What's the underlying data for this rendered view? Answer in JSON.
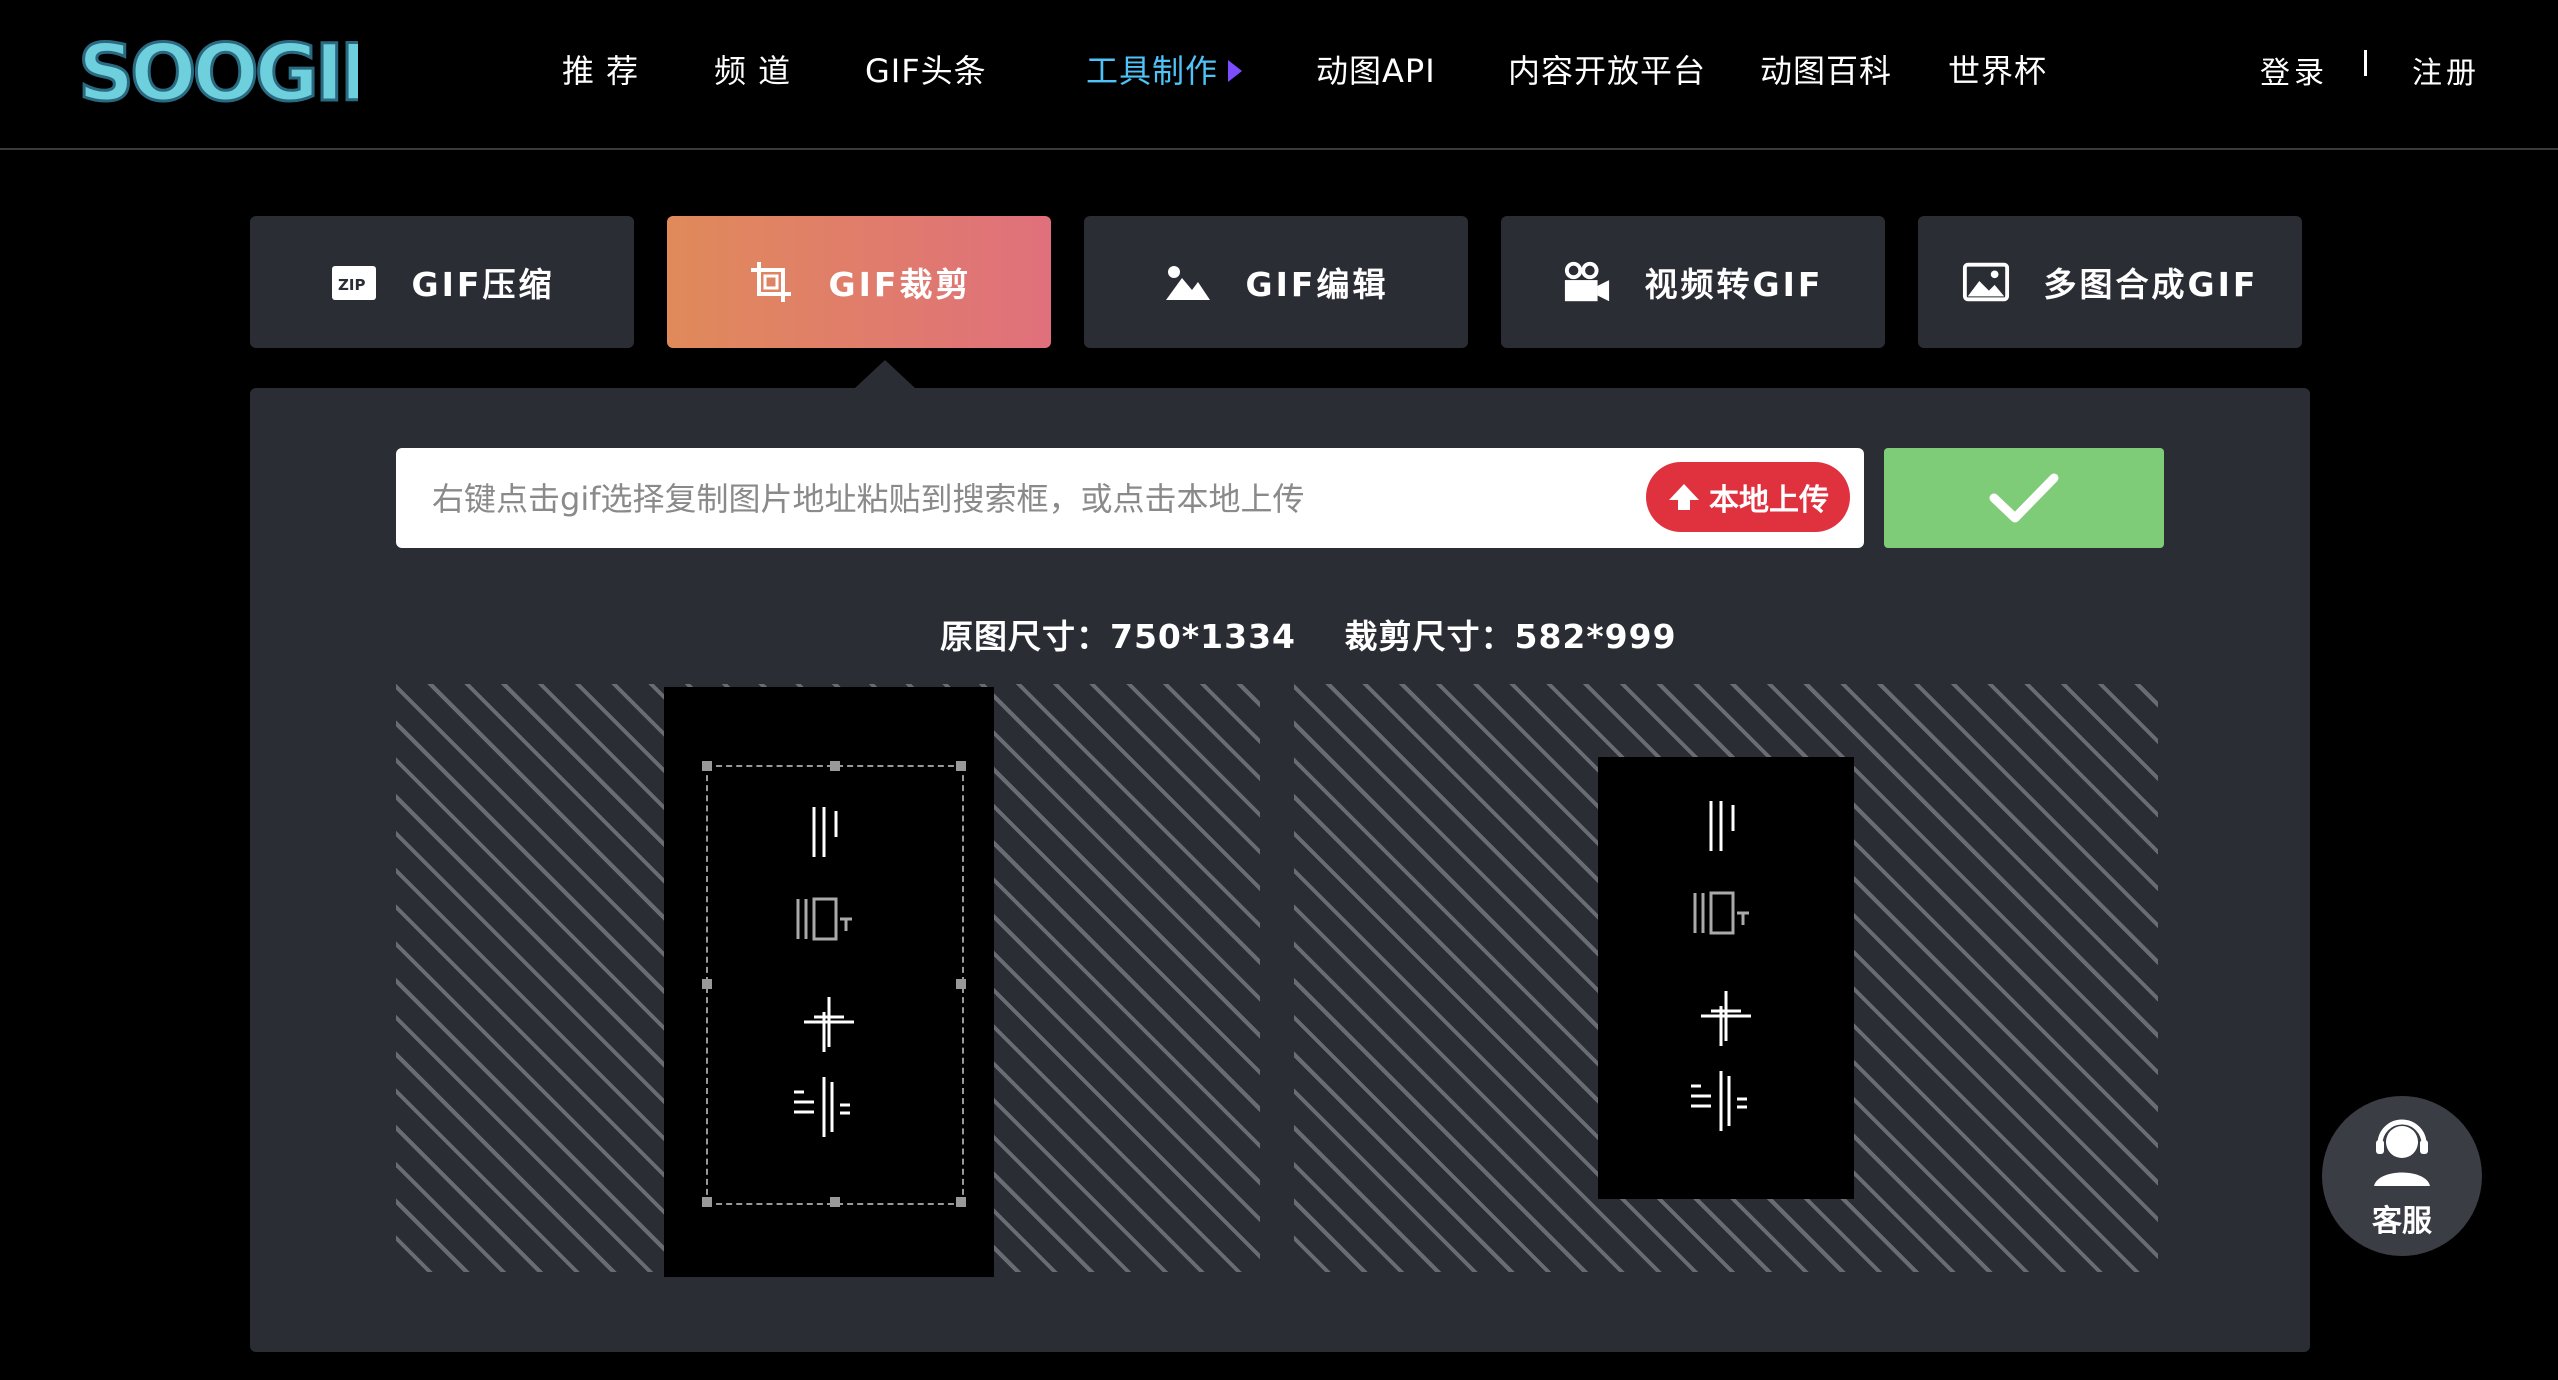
{
  "header": {
    "logo_text": "SOOGIF",
    "nav": [
      {
        "label": "推 荐"
      },
      {
        "label": "频 道"
      },
      {
        "label": "GIF头条"
      },
      {
        "label": "工具制作"
      },
      {
        "label": "动图API"
      },
      {
        "label": "内容开放平台"
      },
      {
        "label": "动图百科"
      },
      {
        "label": "世界杯"
      }
    ],
    "active_nav": "工具制作",
    "login": "登录",
    "register": "注册"
  },
  "tools": [
    {
      "label": "GIF压缩",
      "icon": "zip-file-icon"
    },
    {
      "label": "GIF裁剪",
      "icon": "crop-icon",
      "active": true
    },
    {
      "label": "GIF编辑",
      "icon": "image-edit-icon"
    },
    {
      "label": "视频转GIF",
      "icon": "video-camera-icon"
    },
    {
      "label": "多图合成GIF",
      "icon": "images-icon"
    }
  ],
  "search": {
    "placeholder": "右键点击gif选择复制图片地址粘贴到搜索框，或点击本地上传",
    "value": "",
    "upload_label": "本地上传"
  },
  "sizes": {
    "original": "原图尺寸：750*1334",
    "crop": "裁剪尺寸：582*999"
  },
  "preview_glyphs": [
    "||",
    "[□⌐",
    "+",
    "⌊|="
  ],
  "service": {
    "label": "客服"
  },
  "colors": {
    "accent": "#4fc3f7",
    "active_tab_start": "#e08a5a",
    "active_tab_end": "#e0707c",
    "upload": "#e0313f",
    "confirm": "#7fcc78",
    "panel": "#2b2d35"
  }
}
